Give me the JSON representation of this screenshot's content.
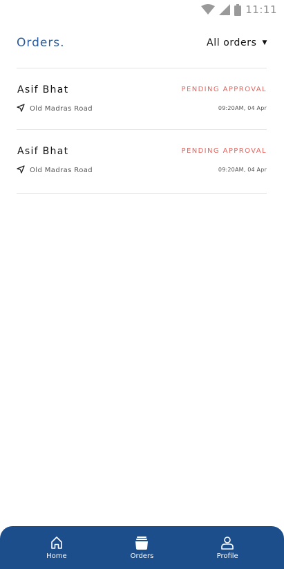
{
  "status_bar": {
    "time": "11:11",
    "icons": [
      "wifi-icon",
      "signal-icon",
      "battery-icon"
    ]
  },
  "header": {
    "title": "Orders.",
    "filter_label": "All orders",
    "filter_icon": "caret-down-icon"
  },
  "orders": [
    {
      "name": "Asif Bhat",
      "status": "PENDING APPROVAL",
      "location": "Old Madras Road",
      "time": "09:20AM, 04 Apr"
    },
    {
      "name": "Asif Bhat",
      "status": "PENDING APPROVAL",
      "location": "Old Madras Road",
      "time": "09:20AM, 04 Apr"
    }
  ],
  "bottom_nav": {
    "items": [
      {
        "label": "Home",
        "icon": "home-icon"
      },
      {
        "label": "Orders",
        "icon": "orders-icon"
      },
      {
        "label": "Profile",
        "icon": "profile-icon"
      }
    ]
  },
  "colors": {
    "brand": "#1d4e8c",
    "title": "#2a5a9a",
    "status_pending": "#e5645e",
    "divider": "#e2e2e2"
  }
}
